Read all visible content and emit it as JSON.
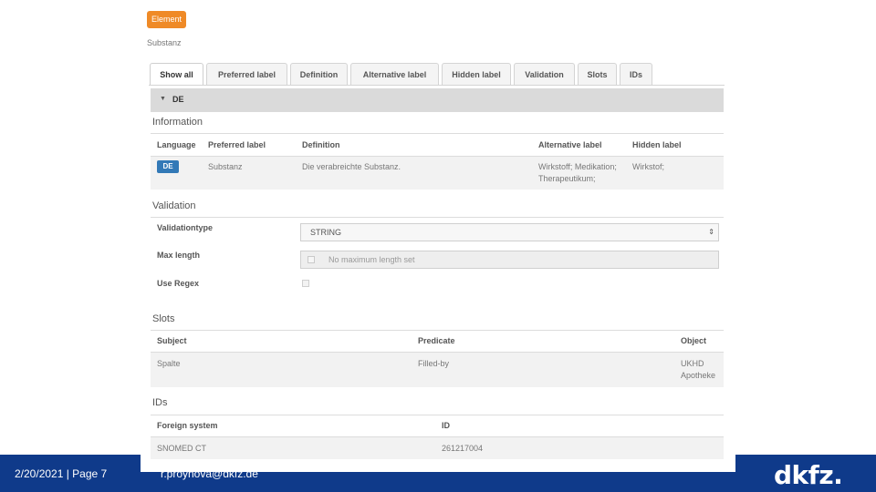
{
  "element_badge": "Element",
  "subtitle": "Substanz",
  "tabs": [
    {
      "label": "Show all",
      "active": true
    },
    {
      "label": "Preferred label"
    },
    {
      "label": "Definition"
    },
    {
      "label": "Alternative label"
    },
    {
      "label": "Hidden label"
    },
    {
      "label": "Validation"
    },
    {
      "label": "Slots"
    },
    {
      "label": "IDs"
    }
  ],
  "de_section": {
    "title": "DE"
  },
  "information": {
    "title": "Information",
    "headers": [
      "Language",
      "Preferred label",
      "Definition",
      "Alternative label",
      "Hidden label"
    ],
    "row": {
      "language": "DE",
      "preferred": "Substanz",
      "definition": "Die verabreichte Substanz.",
      "alternative_line1": "Wirkstoff; Medikation;",
      "alternative_line2": "Therapeutikum;",
      "hidden": "Wirkstof;"
    }
  },
  "validation": {
    "title": "Validation",
    "type_label": "Validationtype",
    "type_value": "STRING",
    "maxlen_label": "Max length",
    "maxlen_placeholder": "No maximum length set",
    "regex_label": "Use Regex"
  },
  "slots": {
    "title": "Slots",
    "headers": [
      "Subject",
      "Predicate",
      "Object"
    ],
    "row": {
      "subject": "Spalte",
      "predicate": "Filled-by",
      "object_line1": "UKHD",
      "object_line2": "Apotheke"
    }
  },
  "ids": {
    "title": "IDs",
    "headers": [
      "Foreign system",
      "ID"
    ],
    "row": {
      "system": "SNOMED CT",
      "id": "261217004"
    }
  },
  "footer": {
    "date_page": "2/20/2021  |  Page 7",
    "email": "r.proynova@dkfz.de",
    "logo": "dkfz."
  },
  "colors": {
    "footer": "#0f3a8a",
    "badge": "#ef8a27",
    "pill": "#3279b7"
  }
}
